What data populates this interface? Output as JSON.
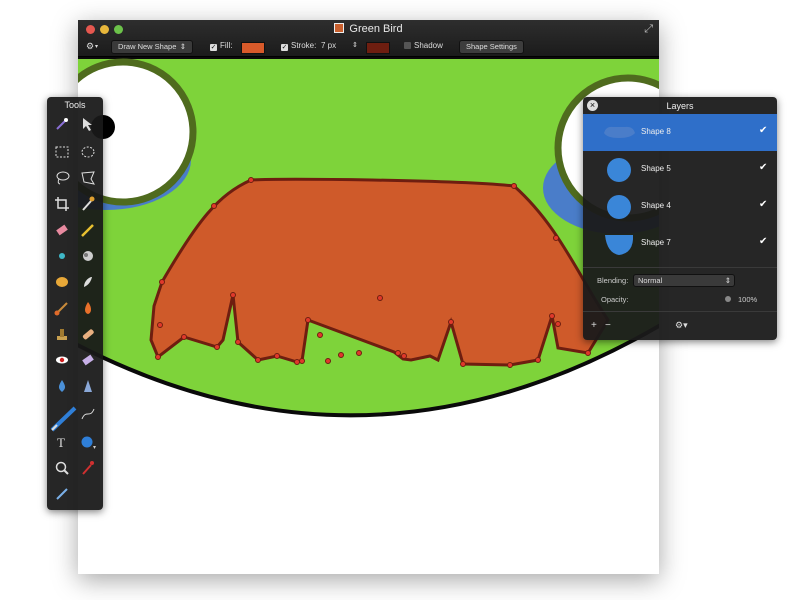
{
  "window": {
    "title": "Green Bird"
  },
  "toolbar": {
    "mode_select": "Draw New Shape",
    "fill_label": "Fill:",
    "stroke_label": "Stroke:",
    "stroke_size": "7 px",
    "shadow_label": "Shadow",
    "shape_settings_label": "Shape Settings",
    "fill_checked": true,
    "stroke_checked": true,
    "shadow_checked": false
  },
  "colors": {
    "fill": "#d85a2a",
    "stroke_color": "#6e1e10",
    "bird_green": "#7ed33a",
    "dark_green": "#4f6b1e",
    "mustache": "#cf5a2a",
    "selection_blue": "#2f6fc9"
  },
  "tools_panel": {
    "title": "Tools"
  },
  "layers_panel": {
    "title": "Layers",
    "layers": [
      {
        "name": "Shape 8",
        "visible": true,
        "selected": true
      },
      {
        "name": "Shape 5",
        "visible": true,
        "selected": false
      },
      {
        "name": "Shape 4",
        "visible": true,
        "selected": false
      },
      {
        "name": "Shape 7",
        "visible": true,
        "selected": false
      }
    ],
    "blending_label": "Blending:",
    "blending_value": "Normal",
    "opacity_label": "Opacity:",
    "opacity_value": "100%"
  }
}
